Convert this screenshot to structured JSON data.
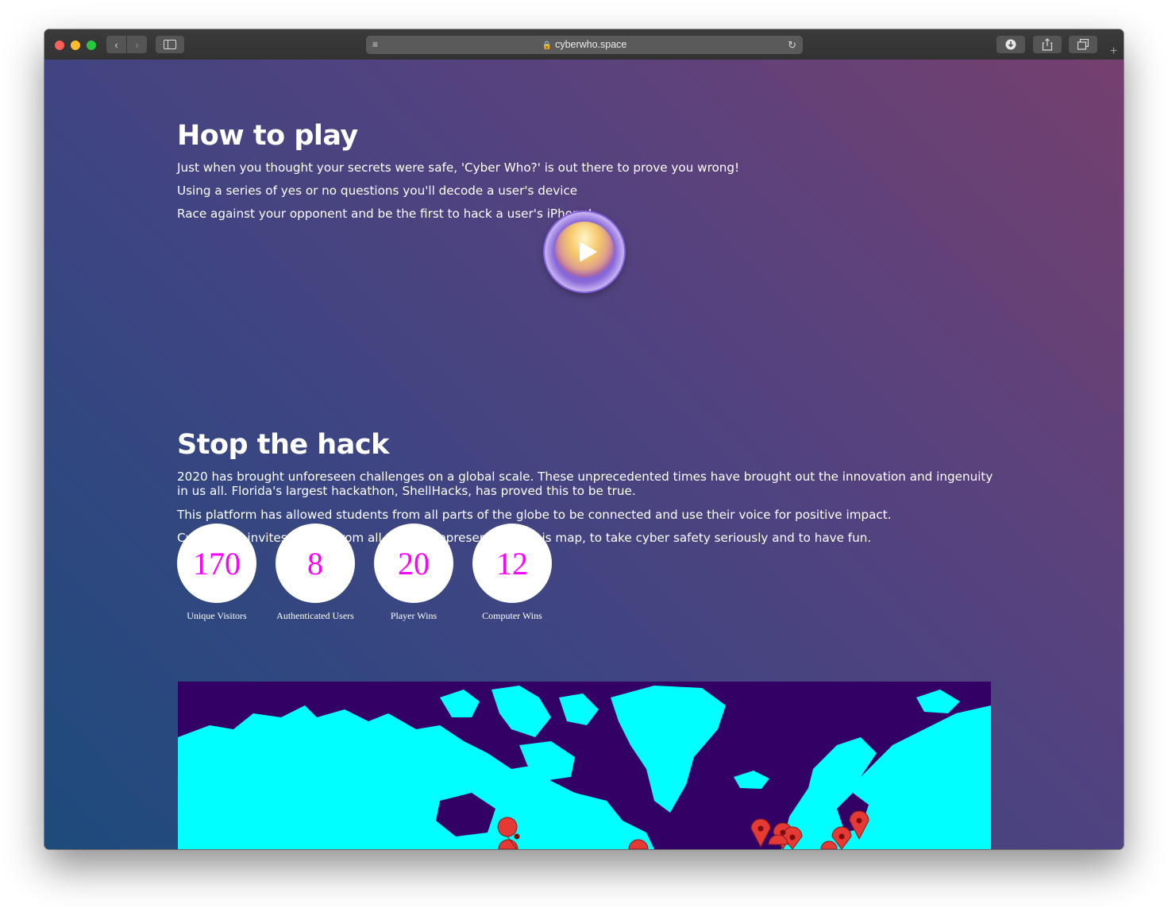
{
  "browser": {
    "url": "cyberwho.space",
    "colors": {
      "chrome": "#323232",
      "url_bar": "#5a5a5a"
    }
  },
  "how_to_play": {
    "title": "How to play",
    "paragraphs": [
      "Just when you thought your secrets were safe, 'Cyber Who?' is out there to prove you wrong!",
      "Using a series of yes or no questions you'll decode a user's device",
      "Race against your opponent and be the first to hack a user's iPhone!"
    ]
  },
  "stop_the_hack": {
    "title": "Stop the hack",
    "paragraphs": [
      "2020 has brought unforeseen challenges on a global scale. These unprecedented times have brought out the innovation and ingenuity in us all. Florida's largest hackathon, ShellHacks, has proved this to be true.",
      "This platform has allowed students from all parts of the globe to be connected and use their voice for positive impact.",
      "Cyber Who invites people from all regions represented on this map, to take cyber safety seriously and to have fun."
    ]
  },
  "stats": [
    {
      "value": "170",
      "label": "Unique Visitors"
    },
    {
      "value": "8",
      "label": "Authenticated Users"
    },
    {
      "value": "20",
      "label": "Player Wins"
    },
    {
      "value": "12",
      "label": "Computer Wins"
    }
  ],
  "map": {
    "colors": {
      "water": "#330066",
      "land": "#00ffff",
      "marker": "#e53935"
    }
  }
}
